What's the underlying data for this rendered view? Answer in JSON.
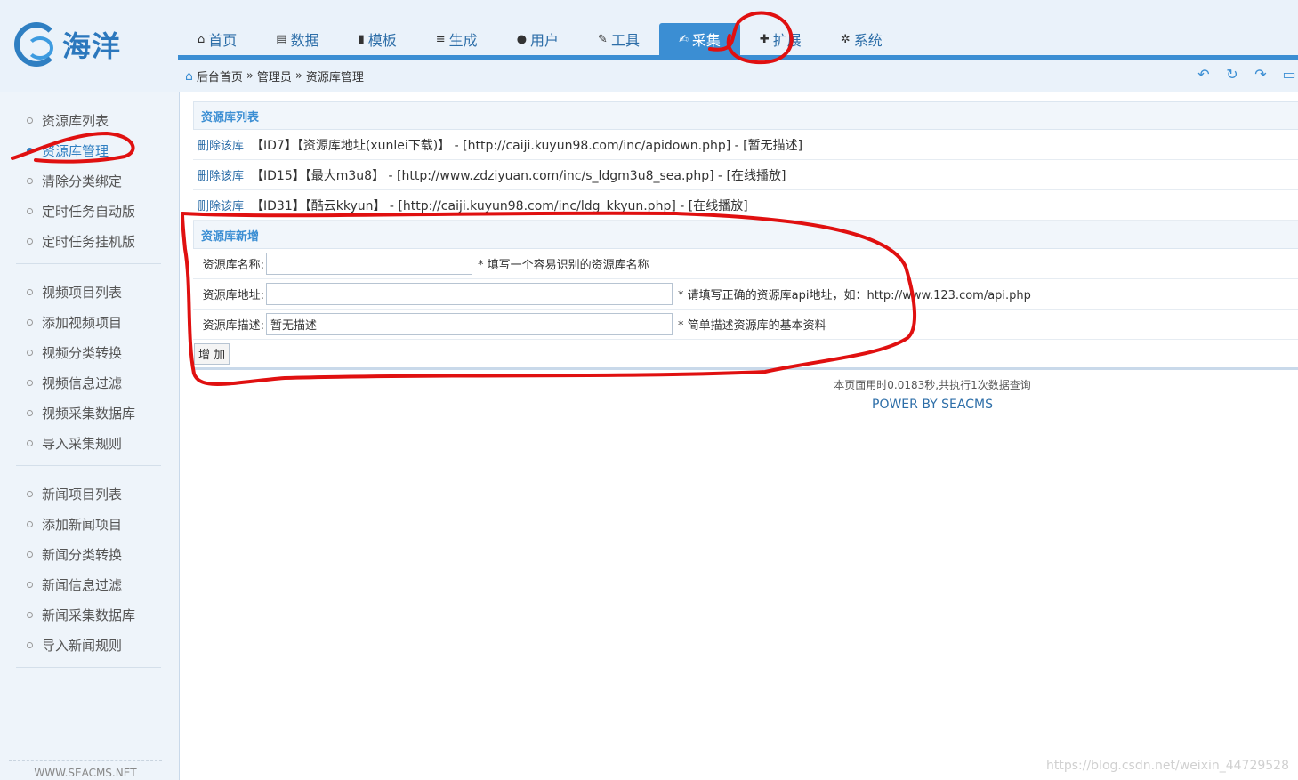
{
  "logo": {
    "text": "海洋"
  },
  "nav": [
    {
      "icon": "home-icon",
      "glyph": "⌂",
      "label": "首页",
      "active": false
    },
    {
      "icon": "book-icon",
      "glyph": "▤",
      "label": "数据",
      "active": false
    },
    {
      "icon": "file-icon",
      "glyph": "▮",
      "label": "模板",
      "active": false
    },
    {
      "icon": "stack-icon",
      "glyph": "≡",
      "label": "生成",
      "active": false
    },
    {
      "icon": "user-icon",
      "glyph": "●",
      "label": "用户",
      "active": false
    },
    {
      "icon": "wrench-icon",
      "glyph": "✎",
      "label": "工具",
      "active": false
    },
    {
      "icon": "edit-icon",
      "glyph": "✍",
      "label": "采集",
      "active": true
    },
    {
      "icon": "puzzle-icon",
      "glyph": "✚",
      "label": "扩展",
      "active": false
    },
    {
      "icon": "gear-icon",
      "glyph": "✲",
      "label": "系统",
      "active": false
    }
  ],
  "breadcrumb": {
    "home": "后台首页",
    "level2": "管理员",
    "current": "资源库管理",
    "sep": "»"
  },
  "sidebar": {
    "groups": [
      {
        "items": [
          {
            "label": "资源库列表",
            "active": false
          },
          {
            "label": "资源库管理",
            "active": true
          },
          {
            "label": "清除分类绑定",
            "active": false
          },
          {
            "label": "定时任务自动版",
            "active": false
          },
          {
            "label": "定时任务挂机版",
            "active": false
          }
        ]
      },
      {
        "items": [
          {
            "label": "视频项目列表",
            "active": false
          },
          {
            "label": "添加视频项目",
            "active": false
          },
          {
            "label": "视频分类转换",
            "active": false
          },
          {
            "label": "视频信息过滤",
            "active": false
          },
          {
            "label": "视频采集数据库",
            "active": false
          },
          {
            "label": "导入采集规则",
            "active": false
          }
        ]
      },
      {
        "items": [
          {
            "label": "新闻项目列表",
            "active": false
          },
          {
            "label": "添加新闻项目",
            "active": false
          },
          {
            "label": "新闻分类转换",
            "active": false
          },
          {
            "label": "新闻信息过滤",
            "active": false
          },
          {
            "label": "新闻采集数据库",
            "active": false
          },
          {
            "label": "导入新闻规则",
            "active": false
          }
        ]
      }
    ],
    "footer": "WWW.SEACMS.NET"
  },
  "list": {
    "title": "资源库列表",
    "delete_label": "删除该库",
    "rows": [
      {
        "text": "【ID7】【资源库地址(xunlei下载)】 - [http://caiji.kuyun98.com/inc/apidown.php] - [暂无描述]"
      },
      {
        "text": "【ID15】【最大m3u8】 - [http://www.zdziyuan.com/inc/s_ldgm3u8_sea.php] - [在线播放]"
      },
      {
        "text": "【ID31】【酷云kkyun】 - [http://caiji.kuyun98.com/inc/ldg_kkyun.php] - [在线播放]"
      }
    ]
  },
  "form": {
    "title": "资源库新增",
    "name_label": "资源库名称:",
    "name_value": "",
    "name_hint": "* 填写一个容易识别的资源库名称",
    "url_label": "资源库地址:",
    "url_value": "",
    "url_hint": "* 请填写正确的资源库api地址，如：http://www.123.com/api.php",
    "desc_label": "资源库描述:",
    "desc_value": "暂无描述",
    "desc_hint": "* 简单描述资源库的基本资料",
    "submit_label": "增 加"
  },
  "footer": {
    "stat": "本页面用时0.0183秒,共执行1次数据查询",
    "power": "POWER BY SEACMS"
  },
  "watermark": "https://blog.csdn.net/weixin_44729528",
  "colors": {
    "accent": "#3b8ed3",
    "annotation": "#e01010"
  }
}
